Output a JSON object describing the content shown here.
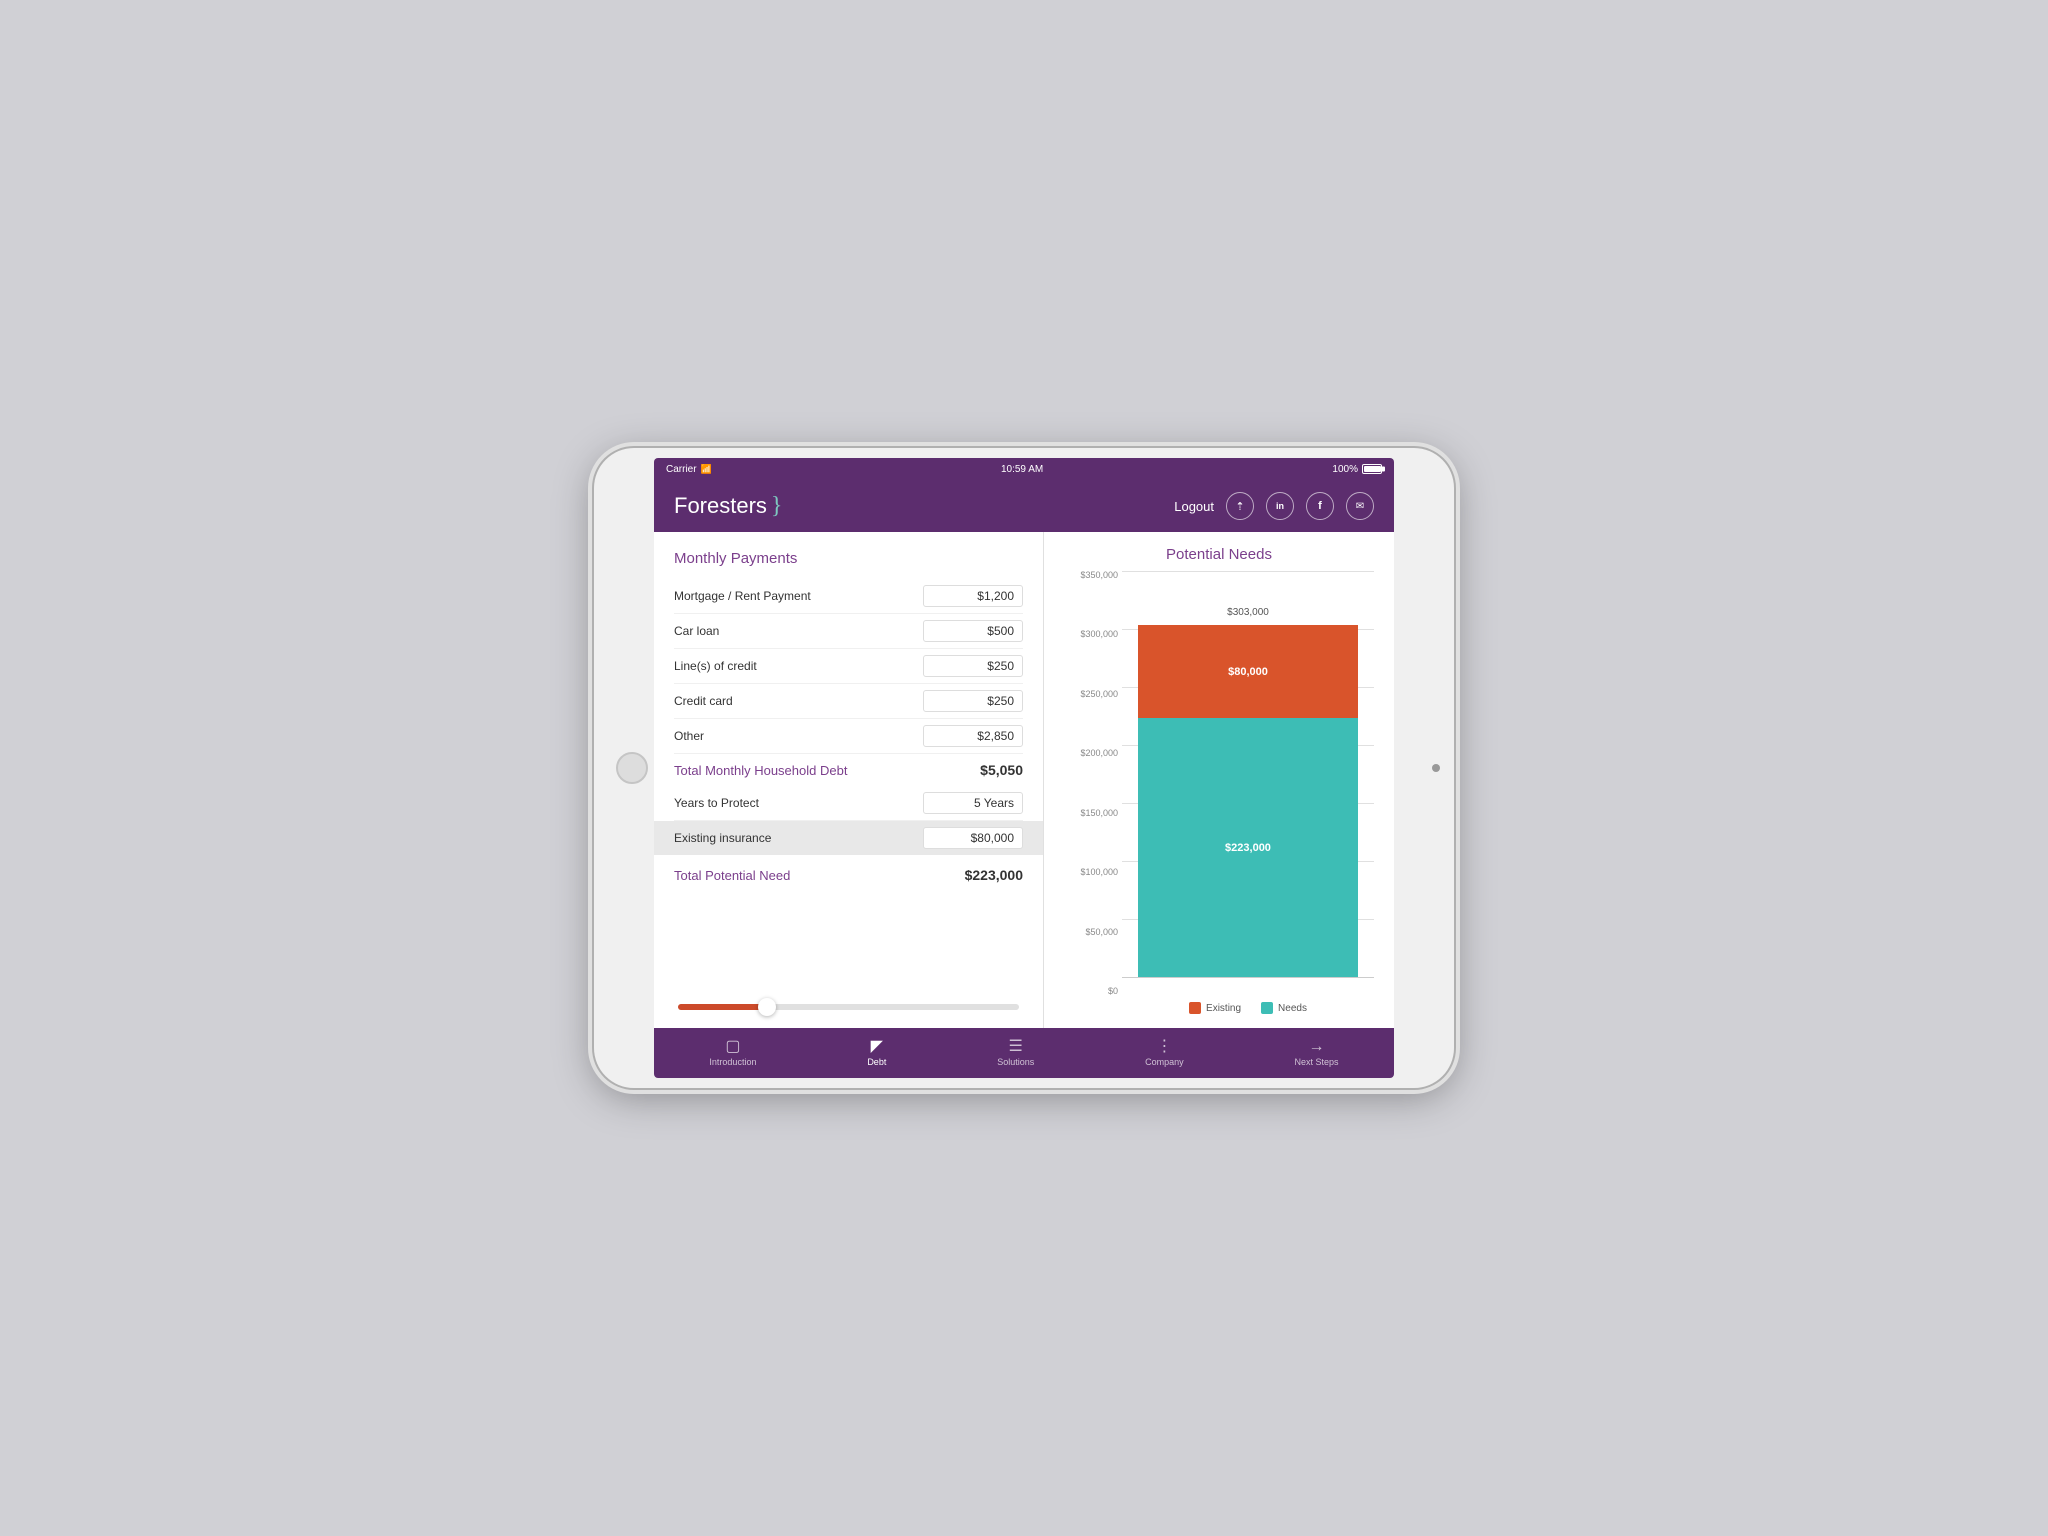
{
  "device": {
    "status_bar": {
      "carrier": "Carrier",
      "wifi_icon": "wifi",
      "time": "10:59 AM",
      "battery_percent": "100%"
    }
  },
  "header": {
    "logo_text": "Foresters",
    "logout_label": "Logout",
    "social_share_title": "share",
    "social_linkedin_title": "linkedin",
    "social_facebook_title": "facebook",
    "social_email_title": "email"
  },
  "left_panel": {
    "section_title": "Monthly Payments",
    "fields": [
      {
        "label": "Mortgage / Rent Payment",
        "value": "$1,200"
      },
      {
        "label": "Car loan",
        "value": "$500"
      },
      {
        "label": "Line(s) of credit",
        "value": "$250"
      },
      {
        "label": "Credit card",
        "value": "$250"
      },
      {
        "label": "Other",
        "value": "$2,850"
      }
    ],
    "total_monthly": {
      "label": "Total Monthly Household Debt",
      "value": "$5,050"
    },
    "years_to_protect": {
      "label": "Years to Protect",
      "value": "5 Years"
    },
    "existing_insurance": {
      "label": "Existing insurance",
      "value": "$80,000"
    },
    "total_potential_need": {
      "label": "Total Potential Need",
      "value": "$223,000"
    },
    "slider": {
      "fill_percent": 28
    }
  },
  "right_panel": {
    "chart_title": "Potential Needs",
    "y_axis_labels": [
      "$350,000",
      "$300,000",
      "$250,000",
      "$200,000",
      "$150,000",
      "$100,000",
      "$50,000",
      "$0"
    ],
    "bar": {
      "total_label": "$303,000",
      "existing_value": "$80,000",
      "needs_value": "$223,000",
      "existing_height_pct": 22.9,
      "needs_height_pct": 63.7,
      "total_height_pct": 86.6
    },
    "legend": {
      "existing_label": "Existing",
      "needs_label": "Needs"
    }
  },
  "bottom_nav": {
    "items": [
      {
        "label": "Introduction",
        "icon": "film",
        "active": false
      },
      {
        "label": "Debt",
        "icon": "columns",
        "active": true
      },
      {
        "label": "Solutions",
        "icon": "layers",
        "active": false
      },
      {
        "label": "Company",
        "icon": "grid",
        "active": false
      },
      {
        "label": "Next Steps",
        "icon": "arrow-right",
        "active": false
      }
    ]
  },
  "colors": {
    "purple": "#5c2d6e",
    "teal": "#3dbdb5",
    "orange": "#d9542b",
    "accent_purple": "#7b3f8c"
  }
}
